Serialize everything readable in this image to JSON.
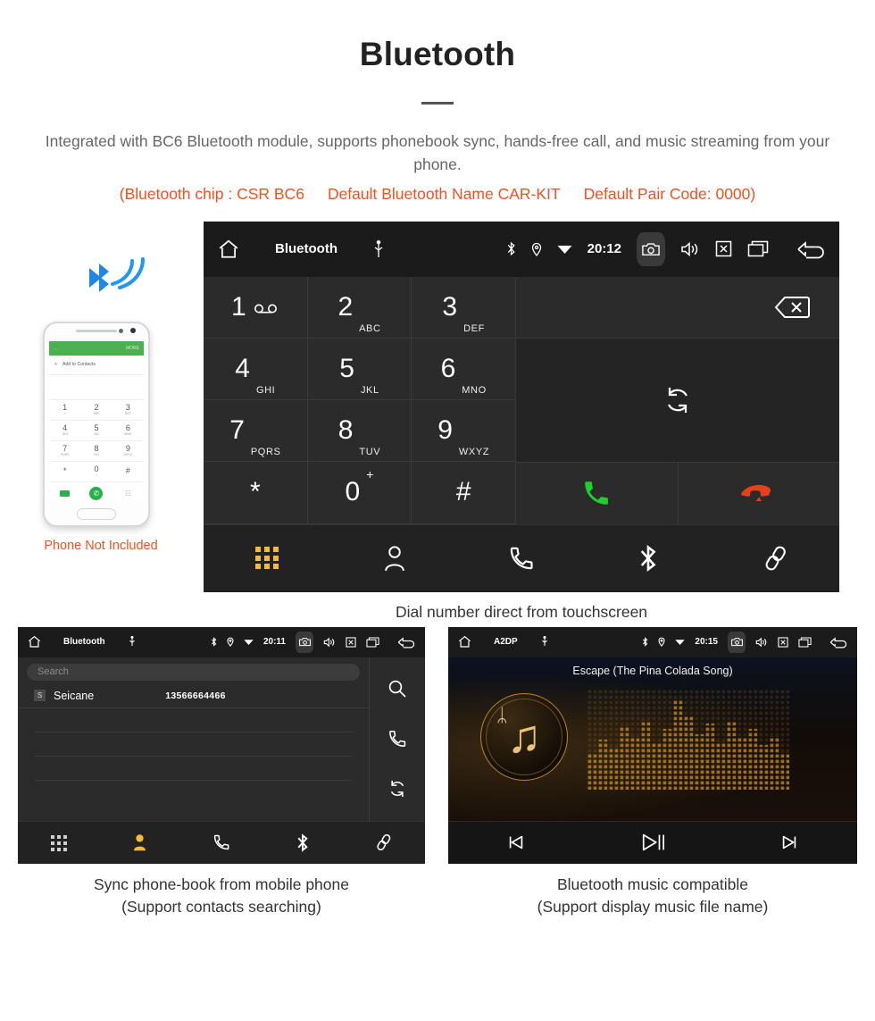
{
  "header": {
    "title": "Bluetooth",
    "description": "Integrated with BC6 Bluetooth module, supports phonebook sync, hands-free call, and music streaming from your phone.",
    "spec_chip": "(Bluetooth chip : CSR BC6",
    "spec_name": "Default Bluetooth Name CAR-KIT",
    "spec_pair": "Default Pair Code: 0000)",
    "accent_color": "#f4511e"
  },
  "phone_mock": {
    "top_bar_more": "MORE",
    "add_contacts": "Add to Contacts",
    "add_plus": "+",
    "back_arrow": "←",
    "keys": [
      {
        "digit": "1",
        "sub": "∞"
      },
      {
        "digit": "2",
        "sub": "ABC"
      },
      {
        "digit": "3",
        "sub": "DEF"
      },
      {
        "digit": "4",
        "sub": "GHI"
      },
      {
        "digit": "5",
        "sub": "JKL"
      },
      {
        "digit": "6",
        "sub": "MNO"
      },
      {
        "digit": "7",
        "sub": "PQRS"
      },
      {
        "digit": "8",
        "sub": "TUV"
      },
      {
        "digit": "9",
        "sub": "WXYZ"
      },
      {
        "digit": "*",
        "sub": ""
      },
      {
        "digit": "0",
        "sub": "+"
      },
      {
        "digit": "#",
        "sub": ""
      }
    ],
    "call_glyph": "✆",
    "note": "Phone Not Included"
  },
  "dialer": {
    "statusbar": {
      "home_icon": "home-icon",
      "title": "Bluetooth",
      "usb_icon": "Ѧ",
      "bluetooth_icon": "ᛦ",
      "location_icon": "⊙",
      "wifi_icon": "▼",
      "clock": "20:12",
      "camera_icon": "camera-icon",
      "volume_icon": "volume-icon",
      "close_icon": "x-box-icon",
      "recents_icon": "recents-icon",
      "back_icon": "back-icon"
    },
    "keys": [
      {
        "digit": "1",
        "sub": "",
        "voicemail": true
      },
      {
        "digit": "2",
        "sub": "ABC"
      },
      {
        "digit": "3",
        "sub": "DEF"
      },
      {
        "digit": "4",
        "sub": "GHI"
      },
      {
        "digit": "5",
        "sub": "JKL"
      },
      {
        "digit": "6",
        "sub": "MNO"
      },
      {
        "digit": "7",
        "sub": "PQRS"
      },
      {
        "digit": "8",
        "sub": "TUV"
      },
      {
        "digit": "9",
        "sub": "WXYZ"
      },
      {
        "digit": "*",
        "sub": ""
      },
      {
        "digit": "0",
        "sub": "+"
      },
      {
        "digit": "#",
        "sub": ""
      }
    ],
    "delete_icon": "backspace-icon",
    "sync_icon": "audio-transfer-icon",
    "call_icon": "call-icon",
    "hangup_icon": "hangup-icon",
    "call_color": "#1bd12e",
    "hangup_color": "#e8401a",
    "tabs": [
      {
        "name": "keypad",
        "active": true
      },
      {
        "name": "contacts",
        "active": false
      },
      {
        "name": "call-log",
        "active": false
      },
      {
        "name": "bluetooth",
        "active": false
      },
      {
        "name": "pair-link",
        "active": false
      }
    ],
    "active_tab_color": "#f6b93b",
    "caption": "Dial number direct from touchscreen"
  },
  "contacts": {
    "statusbar": {
      "title": "Bluetooth",
      "clock": "20:11"
    },
    "search_placeholder": "Search",
    "rows": [
      {
        "badge": "S",
        "name": "Seicane",
        "number": "13566664466"
      }
    ],
    "empty_rows": 3,
    "side_icons": [
      "search-icon",
      "call-icon",
      "sync-icon"
    ],
    "tabs": [
      {
        "name": "keypad",
        "active": false
      },
      {
        "name": "contacts",
        "active": true
      },
      {
        "name": "call-log",
        "active": false
      },
      {
        "name": "bluetooth",
        "active": false
      },
      {
        "name": "pair-link",
        "active": false
      }
    ],
    "caption_line1": "Sync phone-book from mobile phone",
    "caption_line2": "(Support contacts searching)"
  },
  "music": {
    "statusbar": {
      "title": "A2DP",
      "clock": "20:15"
    },
    "song_title": "Escape (The Pina Colada Song)",
    "note_glyph": "♫",
    "bluetooth_glyph": "ᛦ",
    "controls": {
      "prev": "⏮",
      "play_pause": "⏯",
      "next": "⏭"
    },
    "caption_line1": "Bluetooth music compatible",
    "caption_line2": "(Support display music file name)"
  }
}
